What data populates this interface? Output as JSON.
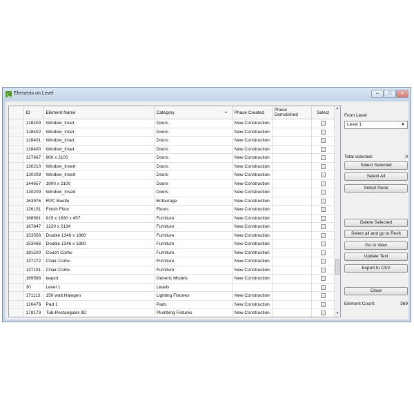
{
  "window": {
    "title": "Elements on Level",
    "min_glyph": "–",
    "max_glyph": "□",
    "close_glyph": "x"
  },
  "grid": {
    "headers": [
      "ID",
      "Element Name",
      "Category",
      "Phase Created",
      "Phase Demolished",
      "Select"
    ],
    "rows": [
      {
        "id": "128409",
        "name": "Window_Inset",
        "category": "Doors",
        "phase_created": "New Construction"
      },
      {
        "id": "128402",
        "name": "Window_Inset",
        "category": "Doors",
        "phase_created": "New Construction"
      },
      {
        "id": "128401",
        "name": "Window_Inset",
        "category": "Doors",
        "phase_created": "New Construction"
      },
      {
        "id": "128400",
        "name": "Window_Inset",
        "category": "Doors",
        "phase_created": "New Construction"
      },
      {
        "id": "127667",
        "name": "800 x 2100",
        "category": "Doors",
        "phase_created": "New Construction"
      },
      {
        "id": "130210",
        "name": "Window_Insert",
        "category": "Doors",
        "phase_created": "New Construction"
      },
      {
        "id": "130208",
        "name": "Window_Insert",
        "category": "Doors",
        "phase_created": "New Construction"
      },
      {
        "id": "144657",
        "name": "1800 x 2100",
        "category": "Doors",
        "phase_created": "New Construction"
      },
      {
        "id": "130209",
        "name": "Window_Insert",
        "category": "Doors",
        "phase_created": "New Construction"
      },
      {
        "id": "163976",
        "name": "RPC Beetle",
        "category": "Entourage",
        "phase_created": "New Construction"
      },
      {
        "id": "126151",
        "name": "Finish Floor",
        "category": "Floors",
        "phase_created": "New Construction"
      },
      {
        "id": "168561",
        "name": "915 x 1830 x 457",
        "category": "Furniture",
        "phase_created": "New Construction"
      },
      {
        "id": "167847",
        "name": "1220 x 2134",
        "category": "Furniture",
        "phase_created": "New Construction"
      },
      {
        "id": "153556",
        "name": "Double 1346 x 1880",
        "category": "Furniture",
        "phase_created": "New Construction"
      },
      {
        "id": "153466",
        "name": "Double 1346 x 1880",
        "category": "Furniture",
        "phase_created": "New Construction"
      },
      {
        "id": "181500",
        "name": "Couch Corbu",
        "category": "Furniture",
        "phase_created": "New Construction"
      },
      {
        "id": "137272",
        "name": "Chair-Corbu",
        "category": "Furniture",
        "phase_created": "New Construction"
      },
      {
        "id": "137191",
        "name": "Chair-Corbu",
        "category": "Furniture",
        "phase_created": "New Construction"
      },
      {
        "id": "169568",
        "name": "teapot",
        "category": "Generic Models",
        "phase_created": "New Construction"
      },
      {
        "id": "30",
        "name": "Level 1",
        "category": "Levels",
        "phase_created": ""
      },
      {
        "id": "171113",
        "name": "150 watt Halogen",
        "category": "Lighting Fixtures",
        "phase_created": "New Construction"
      },
      {
        "id": "126476",
        "name": "Pad 1",
        "category": "Pads",
        "phase_created": "New Construction"
      },
      {
        "id": "178179",
        "name": "Tub-Rectangular-3D",
        "category": "Plumbing Fixtures",
        "phase_created": "New Construction"
      }
    ]
  },
  "side": {
    "from_level_label": "From Level",
    "level_value": "Level 1",
    "total_selected_label": "Total selected:",
    "total_selected_value": "0",
    "buttons": {
      "select_selected": "Select Selected",
      "select_all": "Select All",
      "select_none": "Select None",
      "delete_selected": "Delete Selected",
      "select_all_go_revit": "Select all and go to Revit",
      "go_to_view": "Go to View",
      "update_text": "Update Text",
      "export_csv": "Export to CSV",
      "close": "Close"
    },
    "element_count_label": "Element Count:",
    "element_count_value": "369"
  },
  "icons": {
    "sort": "sort-ascending-icon",
    "dropdown": "chevron-down-icon",
    "scroll_up": "scroll-up-icon",
    "scroll_down": "scroll-down-icon"
  }
}
